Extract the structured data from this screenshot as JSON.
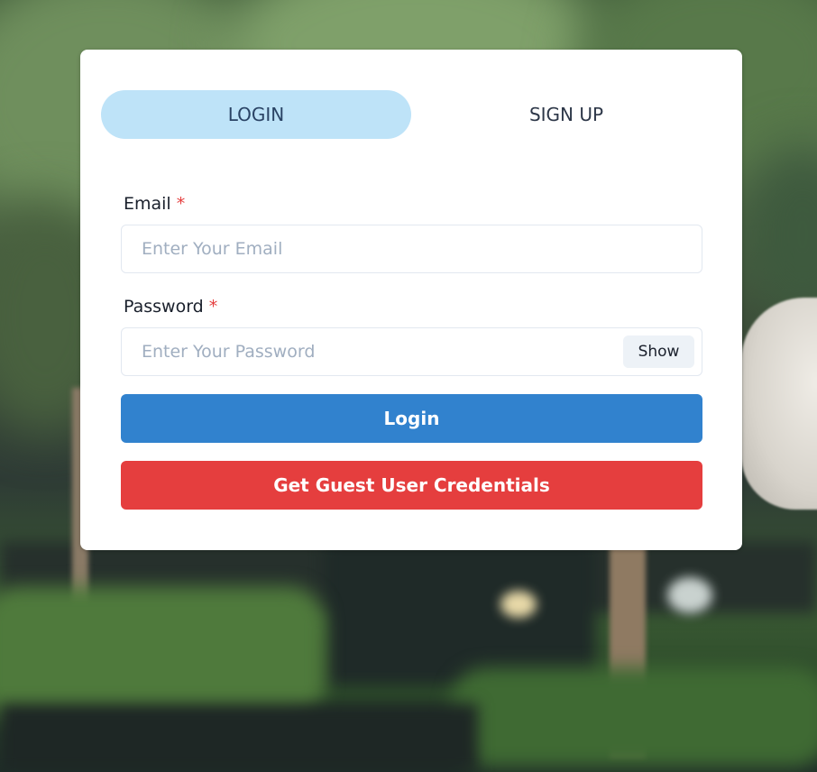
{
  "tabs": {
    "login": "LOGIN",
    "signup": "SIGN UP"
  },
  "form": {
    "email": {
      "label": "Email",
      "required_mark": "*",
      "placeholder": "Enter Your Email",
      "value": ""
    },
    "password": {
      "label": "Password",
      "required_mark": "*",
      "placeholder": "Enter Your Password",
      "value": "",
      "toggle_label": "Show"
    },
    "login_button": "Login",
    "guest_button": "Get Guest User Credentials"
  },
  "colors": {
    "active_tab_bg": "#bee3f8",
    "primary": "#3182ce",
    "danger": "#e53e3e",
    "required": "#e53e3e"
  }
}
